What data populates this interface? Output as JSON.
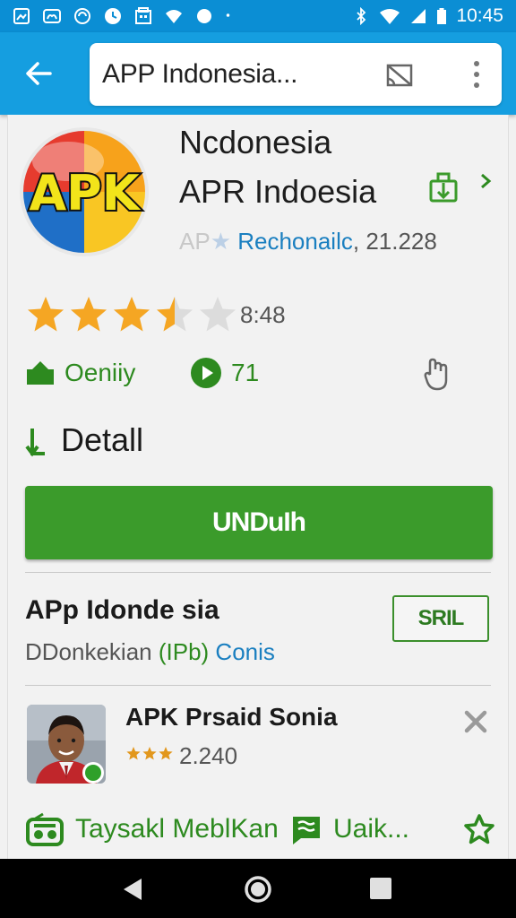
{
  "status_bar": {
    "time": "10:45",
    "icons": [
      "photo-icon",
      "cloud-icon",
      "sync-icon",
      "clock-icon",
      "gallery-icon",
      "wifi-icon",
      "circle-icon",
      "dot-icon",
      "bluetooth-icon",
      "signal-icon",
      "battery-icon"
    ]
  },
  "app_bar": {
    "url_text": "APP Indonesia...",
    "icons": [
      "back-arrow-icon",
      "cast-icon",
      "overflow-menu-icon"
    ]
  },
  "app": {
    "logo_text": "APK",
    "title_line1": "Ncdonesia",
    "title_line2": "APR Indoesia",
    "meta_faded": "AP",
    "meta_developer": "Rechonailc",
    "meta_count": ", 21.228",
    "rating": 3.5,
    "rating_max": 5,
    "rating_count": "8:48",
    "category": "Oeniiy",
    "plays": "71"
  },
  "detail": {
    "label": "Detall"
  },
  "download": {
    "label": "UNDuIh"
  },
  "section": {
    "title": "APp Idonde sia",
    "sub_prefix": "DDonkekian ",
    "sub_green": "(IPb)",
    "sub_blue": " Conis",
    "action_label": "SRIL"
  },
  "related": {
    "title": "APK Prsaid Sonia",
    "rating_value": "2.240",
    "rating": 3,
    "rating_max": 3
  },
  "bottom": {
    "label1": "Taysakl MeblKan",
    "label2": "Uaik..."
  },
  "colors": {
    "status_bar": "#0b8ed4",
    "app_bar": "#159ee0",
    "accent_green": "#3b9b2b",
    "link_blue": "#1a7fc0",
    "star_orange": "#f5a623"
  }
}
